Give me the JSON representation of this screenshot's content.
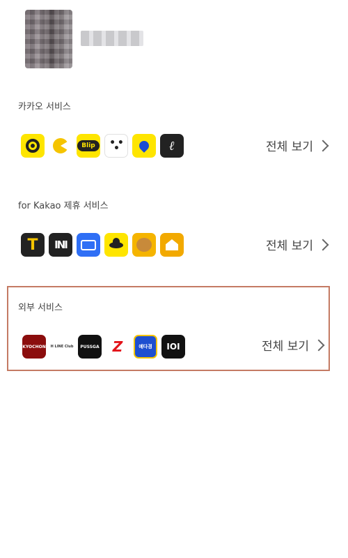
{
  "profile": {
    "avatar_icon": "blurred-profile-photo",
    "name": "■■■ ■"
  },
  "sections": [
    {
      "title": "카카오 서비스",
      "see_all": "전체 보기",
      "apps": [
        {
          "name": "kakao-t-eye-icon"
        },
        {
          "name": "pacman-game-icon"
        },
        {
          "name": "kakao-talk-bubble-icon",
          "text": "Blip"
        },
        {
          "name": "three-dots-icon"
        },
        {
          "name": "map-pin-icon"
        },
        {
          "name": "pen-signature-icon"
        }
      ]
    },
    {
      "title": "for Kakao 제휴 서비스",
      "see_all": "전체 보기",
      "apps": [
        {
          "name": "taxi-t-icon",
          "text": "T"
        },
        {
          "name": "navi-icon",
          "text": "INI"
        },
        {
          "name": "rounded-rect-icon"
        },
        {
          "name": "ufo-icon"
        },
        {
          "name": "bear-character-icon"
        },
        {
          "name": "house-icon"
        }
      ]
    },
    {
      "title": "외부 서비스",
      "see_all": "전체 보기",
      "apps": [
        {
          "name": "kyochon-icon",
          "text": "KYOCHON"
        },
        {
          "name": "h-line-club-icon",
          "text": "H LINE Club"
        },
        {
          "name": "pursuga-icon",
          "text": "PUSSGA"
        },
        {
          "name": "zz-logo-icon",
          "text": "Z"
        },
        {
          "name": "character-portrait-icon",
          "text": "예다경"
        },
        {
          "name": "ioi-icon",
          "text": "IOI"
        }
      ]
    }
  ]
}
